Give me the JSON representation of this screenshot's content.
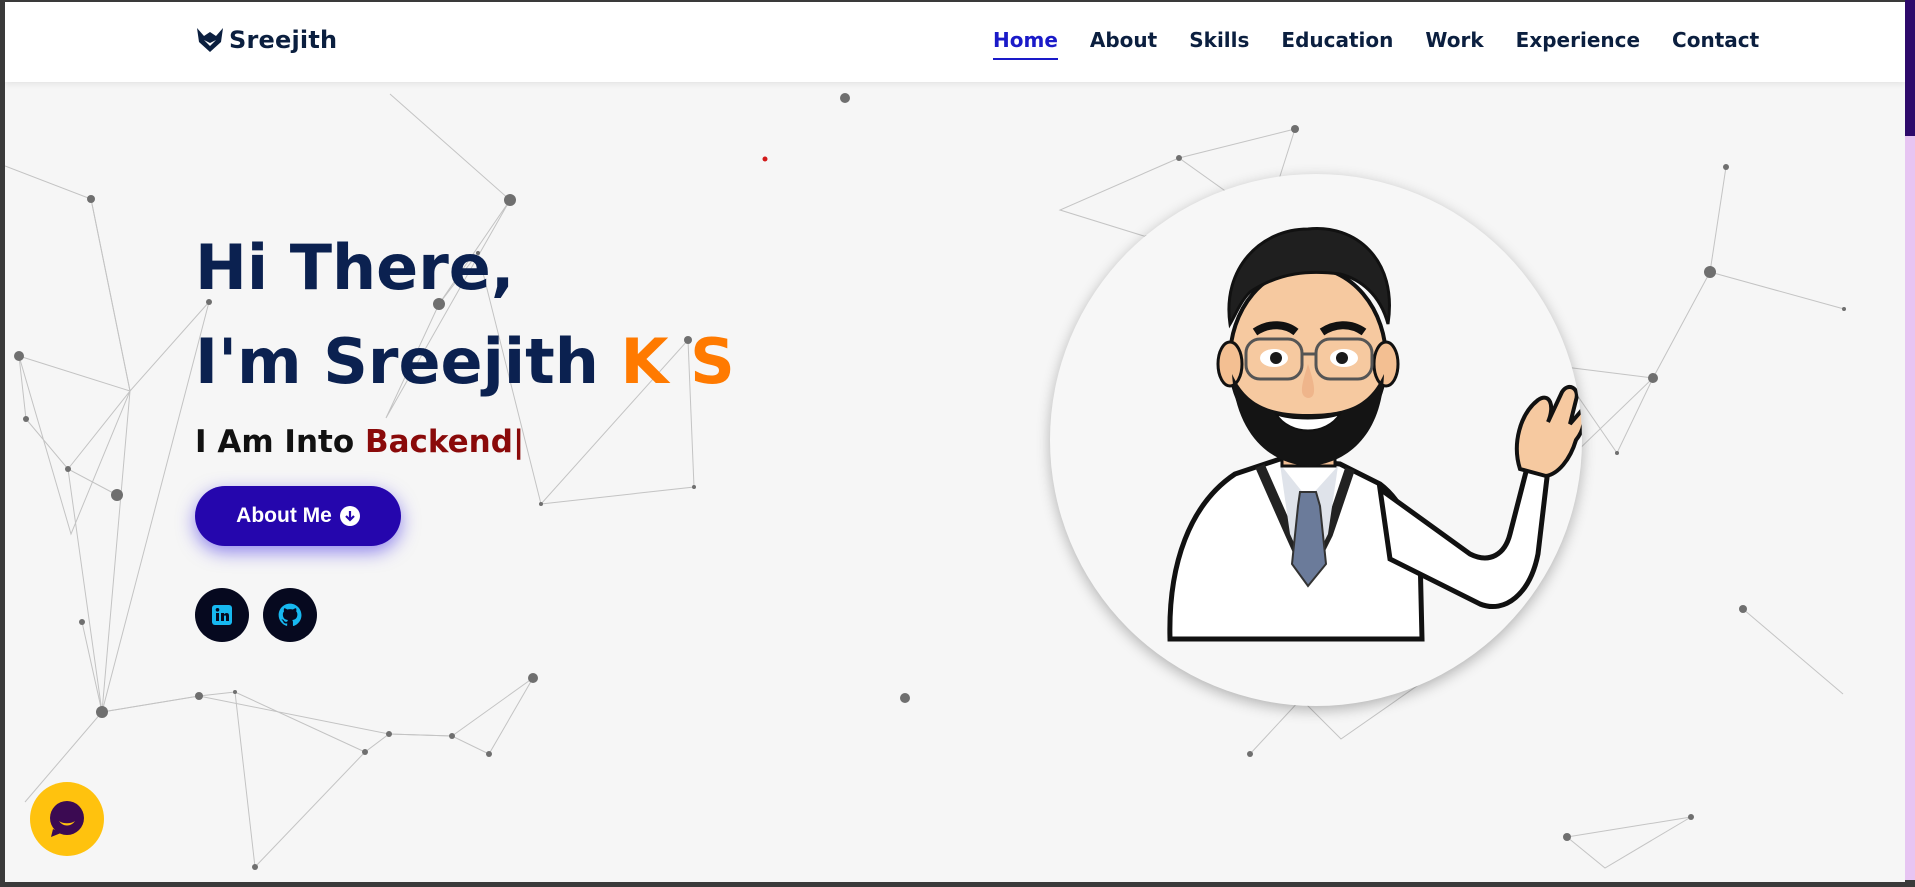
{
  "header": {
    "logo_text": "Sreejith",
    "logo_icon": "fox-icon",
    "nav": [
      {
        "label": "Home",
        "active": true
      },
      {
        "label": "About"
      },
      {
        "label": "Skills"
      },
      {
        "label": "Education"
      },
      {
        "label": "Work"
      },
      {
        "label": "Experience"
      },
      {
        "label": "Contact"
      }
    ]
  },
  "hero": {
    "greeting": "Hi There,",
    "name_prefix": "I'm Sreejith",
    "name_accent": "K S",
    "into_prefix": "I Am Into",
    "into_role": "Backend",
    "cursor": "|",
    "about_button": "About Me",
    "socials": [
      {
        "name": "linkedin-icon"
      },
      {
        "name": "github-icon"
      }
    ]
  },
  "colors": {
    "nav_active": "#1a1ac8",
    "heading": "#0b2150",
    "accent_orange": "#ff7a00",
    "role_red": "#8a0a0a",
    "button": "#2506ad",
    "chat_bubble": "#ffc20e"
  },
  "chat_widget": {
    "icon": "chat-bubble-icon"
  }
}
